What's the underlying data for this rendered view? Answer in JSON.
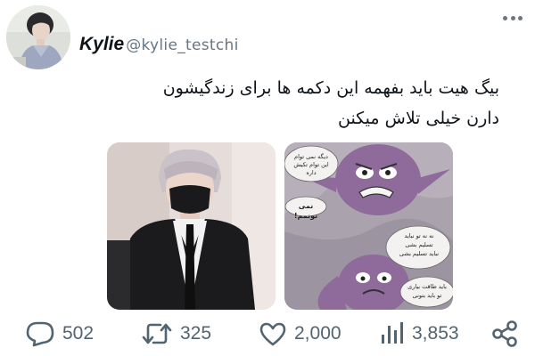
{
  "author": {
    "display_name": "Kylie",
    "handle": "@kylie_testchi"
  },
  "tweet": {
    "text_line_1": "بیگ هیت باید بفهمه این دکمه ها برای زندگیشون",
    "text_line_2": "دارن خیلی تلاش میکنن"
  },
  "media": {
    "comic_bubbles": {
      "top": "دیگه نمی توام\nاین توام تکیش داره",
      "shout": "نمی تونمم!",
      "middle": "نه نه تو نباید\nتسلیم بشی\nنباید تسلیم بشی",
      "bottom": "باید طاقت بیاری\nتو باید بتونی"
    }
  },
  "actions": {
    "replies": "502",
    "retweets": "325",
    "likes": "2,000",
    "views": "3,853"
  },
  "colors": {
    "icon": "#536471",
    "comic_purple": "#9a7aa4",
    "sheet": "#a9a2ad"
  },
  "icons": [
    "more-icon",
    "reply-icon",
    "retweet-icon",
    "like-icon",
    "views-icon",
    "share-icon"
  ]
}
